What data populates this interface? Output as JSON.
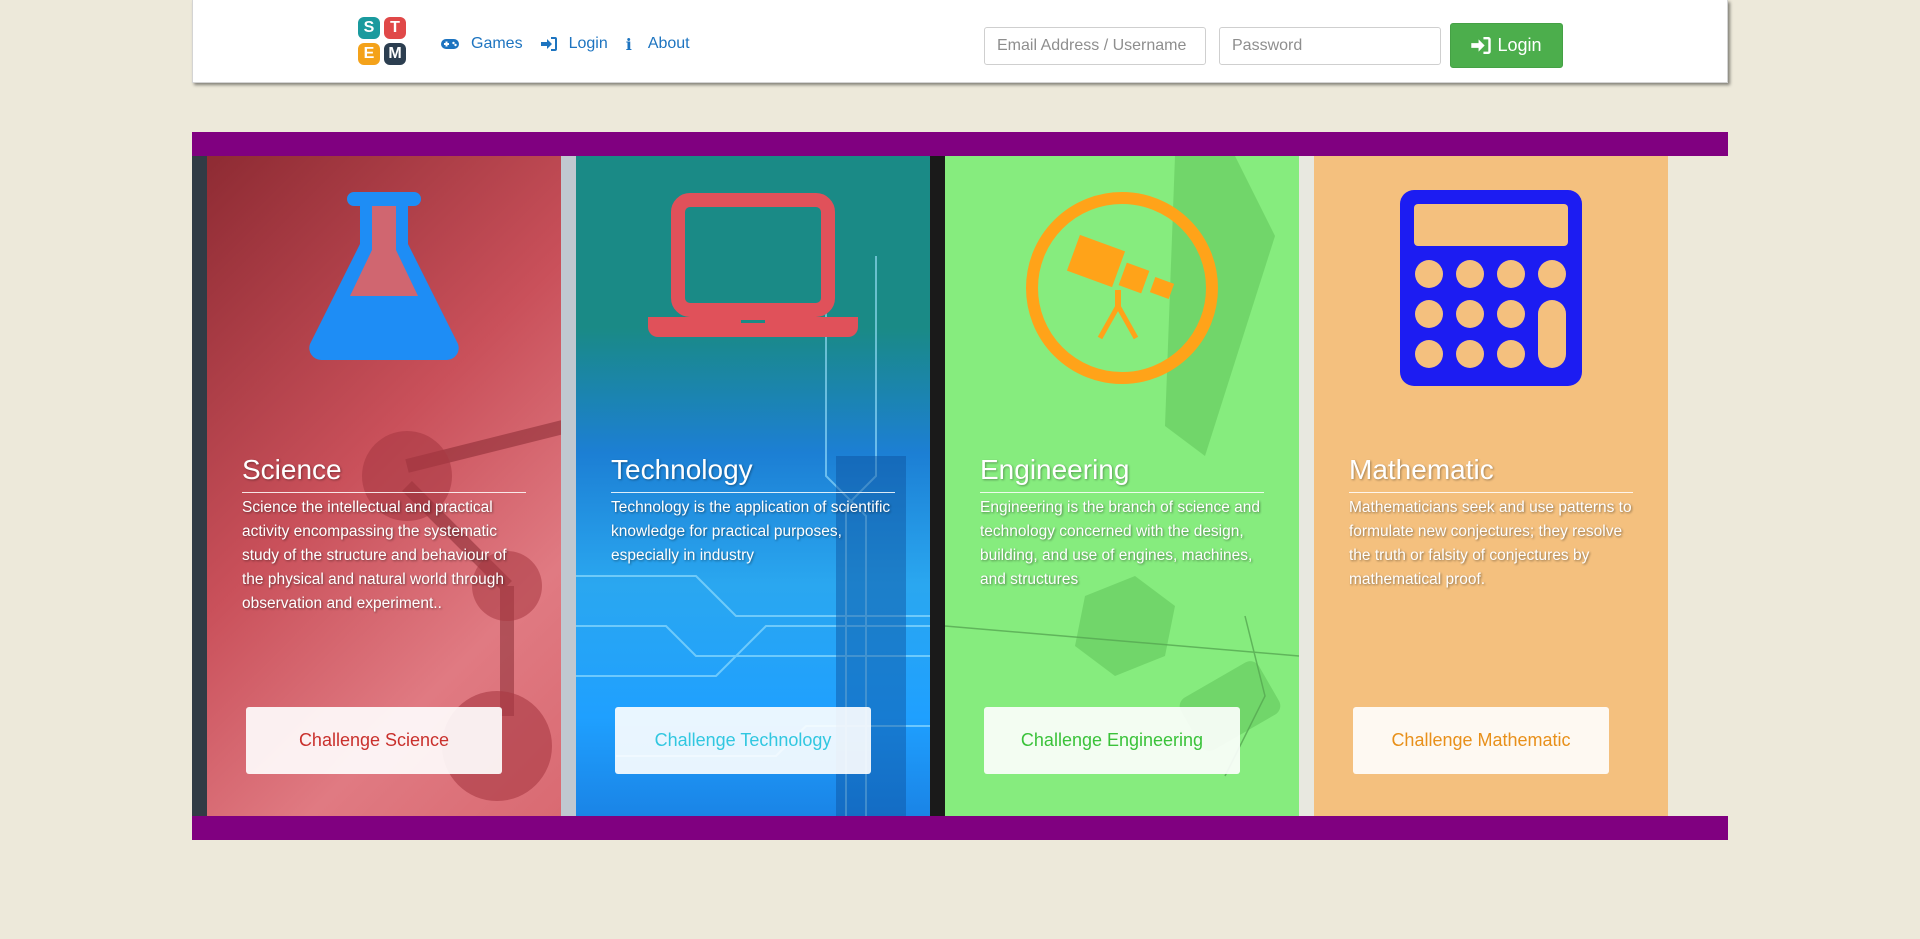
{
  "nav": {
    "logo_letters": [
      "S",
      "T",
      "E",
      "M"
    ],
    "logo_colors": [
      "#1a9a9e",
      "#e04848",
      "#f4a21a",
      "#2c3e50"
    ],
    "links": [
      {
        "icon": "gamepad-icon",
        "label": "Games"
      },
      {
        "icon": "sign-in-icon",
        "label": "Login"
      },
      {
        "icon": "info-icon",
        "label": "About"
      }
    ],
    "email_placeholder": "Email Address / Username",
    "password_placeholder": "Password",
    "login_button": "Login",
    "link_color": "#1d74c0",
    "login_color": "#4cae4c"
  },
  "banner": {
    "border_color": "#800080",
    "cards": [
      {
        "title": "Science",
        "icon": "flask-icon",
        "icon_color": "#1e8df5",
        "overlay_color": "#c94a55",
        "description": "Science the intellectual and practical activity encompassing the systematic study of the structure and behaviour of the physical and natural world through observation and experiment..",
        "button": "Challenge Science",
        "button_color": "#c9302c"
      },
      {
        "title": "Technology",
        "icon": "laptop-icon",
        "icon_color": "#e0515a",
        "overlay_color": "#1a8a86",
        "description": "Technology is the application of scientific knowledge for practical purposes, especially in industry",
        "button": "Challenge Technology",
        "button_color": "#31c7e0"
      },
      {
        "title": "Engineering",
        "icon": "telescope-icon",
        "icon_color": "#ffa319",
        "overlay_color": "#86ec7e",
        "description": "Engineering is the branch of science and technology concerned with the design, building, and use of engines, machines, and structures",
        "button": "Challenge Engineering",
        "button_color": "#3ac23a"
      },
      {
        "title": "Mathematic",
        "icon": "calculator-icon",
        "icon_color": "#1c1cf2",
        "overlay_color": "#f4c07e",
        "description": "Mathematicians seek and use patterns to formulate new conjectures; they resolve the truth or falsity of conjectures by mathematical proof.",
        "button": "Challenge Mathematic",
        "button_color": "#e8901a"
      }
    ]
  }
}
